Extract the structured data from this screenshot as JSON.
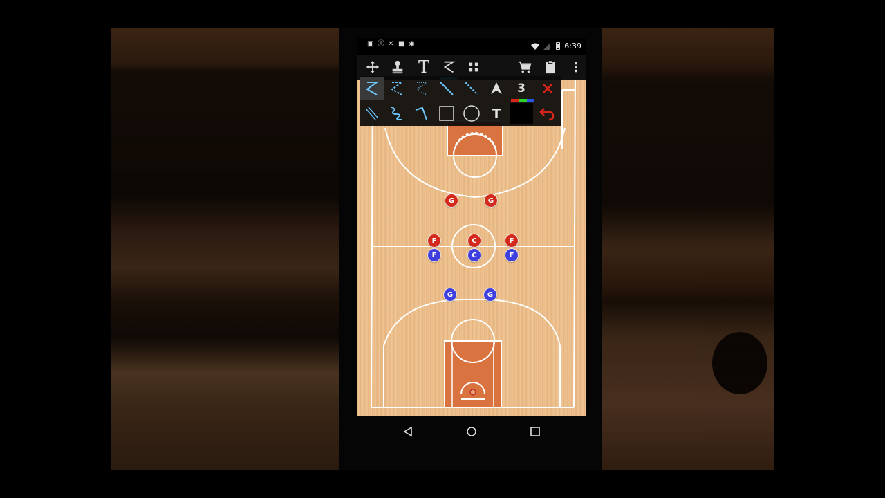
{
  "status_bar": {
    "time": "6:39",
    "left_icons": [
      "image-icon",
      "alert-icon",
      "tools-icon",
      "lock-icon",
      "android-icon"
    ],
    "right_icons": [
      "wifi-icon",
      "signal-icon",
      "battery-icon"
    ]
  },
  "toolbar": {
    "items": [
      {
        "name": "move-icon",
        "active": false
      },
      {
        "name": "stamp-icon",
        "active": false
      },
      {
        "name": "text-icon",
        "label": "T",
        "active": false
      },
      {
        "name": "draw-line-icon",
        "active": true
      },
      {
        "name": "grid-icon",
        "active": false
      },
      {
        "name": "cart-icon",
        "active": false
      },
      {
        "name": "clipboard-icon",
        "active": false
      },
      {
        "name": "overflow-menu-icon",
        "active": false
      }
    ]
  },
  "tool_panel": {
    "row1": [
      "solid-curve-tool",
      "dashed-curve-tool",
      "dotted-curve-tool",
      "straight-line-tool",
      "dashed-line-tool",
      "arrowhead-tool",
      "line-width",
      "delete-tool"
    ],
    "row2": [
      "double-line-tool",
      "zigzag-tool",
      "bent-line-tool",
      "rectangle-tool",
      "circle-tool",
      "text-tool",
      "color-swatch",
      "undo-tool"
    ],
    "line_width": "3",
    "text_tool_label": "T",
    "selected_tool": "solid-curve-tool",
    "colors": {
      "delete": "#d9251a",
      "undo": "#d9251a",
      "swatch_bg": "#000000",
      "palette": [
        "#d9251a",
        "#2bd12b",
        "#2a55e6"
      ]
    }
  },
  "court": {
    "colors": {
      "wood": "#eec290",
      "paint": "#d9733f",
      "lines": "#ffffff"
    }
  },
  "players": {
    "red": [
      {
        "label": "G"
      },
      {
        "label": "G"
      },
      {
        "label": "F"
      },
      {
        "label": "C"
      },
      {
        "label": "F"
      }
    ],
    "blue": [
      {
        "label": "F"
      },
      {
        "label": "C"
      },
      {
        "label": "F"
      },
      {
        "label": "G"
      },
      {
        "label": "G"
      }
    ],
    "colors": {
      "red": "#d42a1e",
      "blue": "#3f3fe0"
    }
  },
  "nav_bar": {
    "items": [
      "back-icon",
      "home-icon",
      "recents-icon"
    ]
  }
}
